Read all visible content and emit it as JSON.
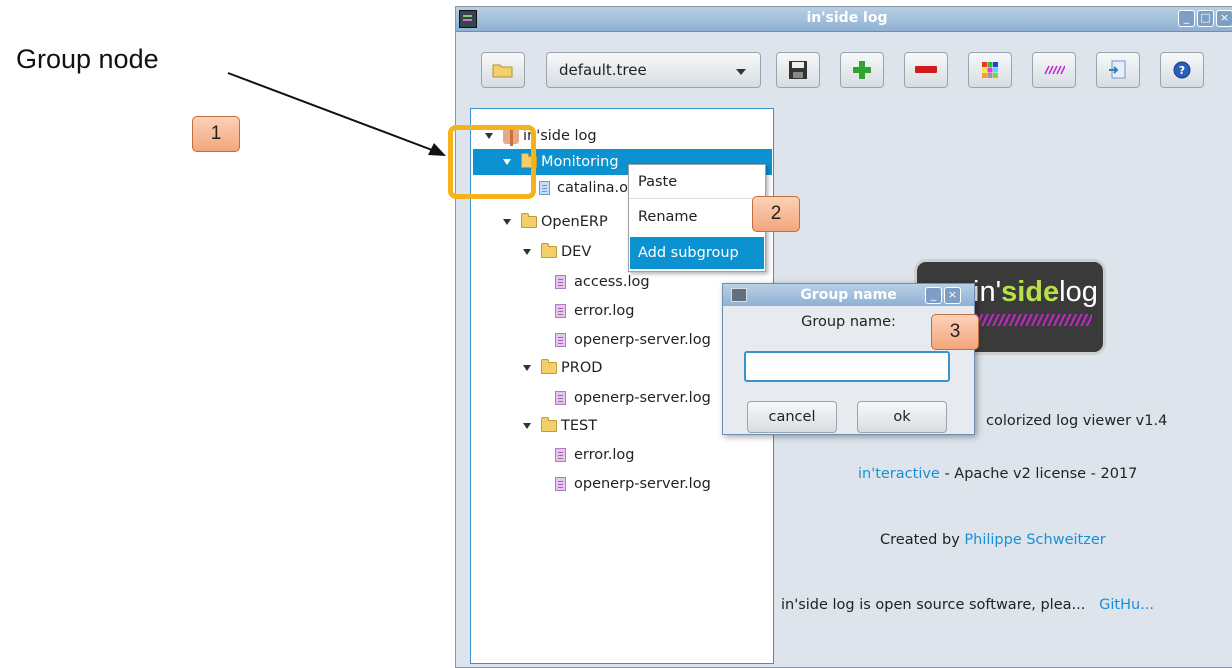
{
  "annotation": {
    "title": "Group node",
    "badges": [
      "1",
      "2",
      "3"
    ]
  },
  "window": {
    "title": "in'side log",
    "buttons": [
      "minimize",
      "maximize",
      "close"
    ]
  },
  "toolbar": {
    "tree_select_value": "default.tree",
    "icons": [
      "open-folder-icon",
      "save-icon",
      "add-icon",
      "remove-icon",
      "color-palette-icon",
      "stripes-icon",
      "export-icon",
      "help-icon"
    ]
  },
  "tree": {
    "root": "in'side log",
    "monitoring": "Monitoring",
    "catalina": "catalina.out",
    "openerp": "OpenERP",
    "dev": "DEV",
    "dev_access": "access.log",
    "dev_error": "error.log",
    "dev_server": "openerp-server.log",
    "prod": "PROD",
    "prod_server": "openerp-server.log",
    "test": "TEST",
    "test_error": "error.log",
    "test_server": "openerp-server.log"
  },
  "context_menu": {
    "items": [
      "Paste",
      "Rename",
      "Add subgroup"
    ]
  },
  "about": {
    "logo_prefix": "in'",
    "logo_side": "side",
    "logo_suffix": "log",
    "description": "colorized log viewer v1.4",
    "company_link": "in'teractive",
    "license": " - Apache v2 license - 2017",
    "created_by": "Created by ",
    "author_link": "Philippe Schweitzer",
    "open_source": "in'side log is open source software, plea...",
    "github_link": "GitHu..."
  },
  "dialog": {
    "title": "Group name",
    "label": "Group name:",
    "input_value": "",
    "cancel_label": "cancel",
    "ok_label": "ok"
  }
}
